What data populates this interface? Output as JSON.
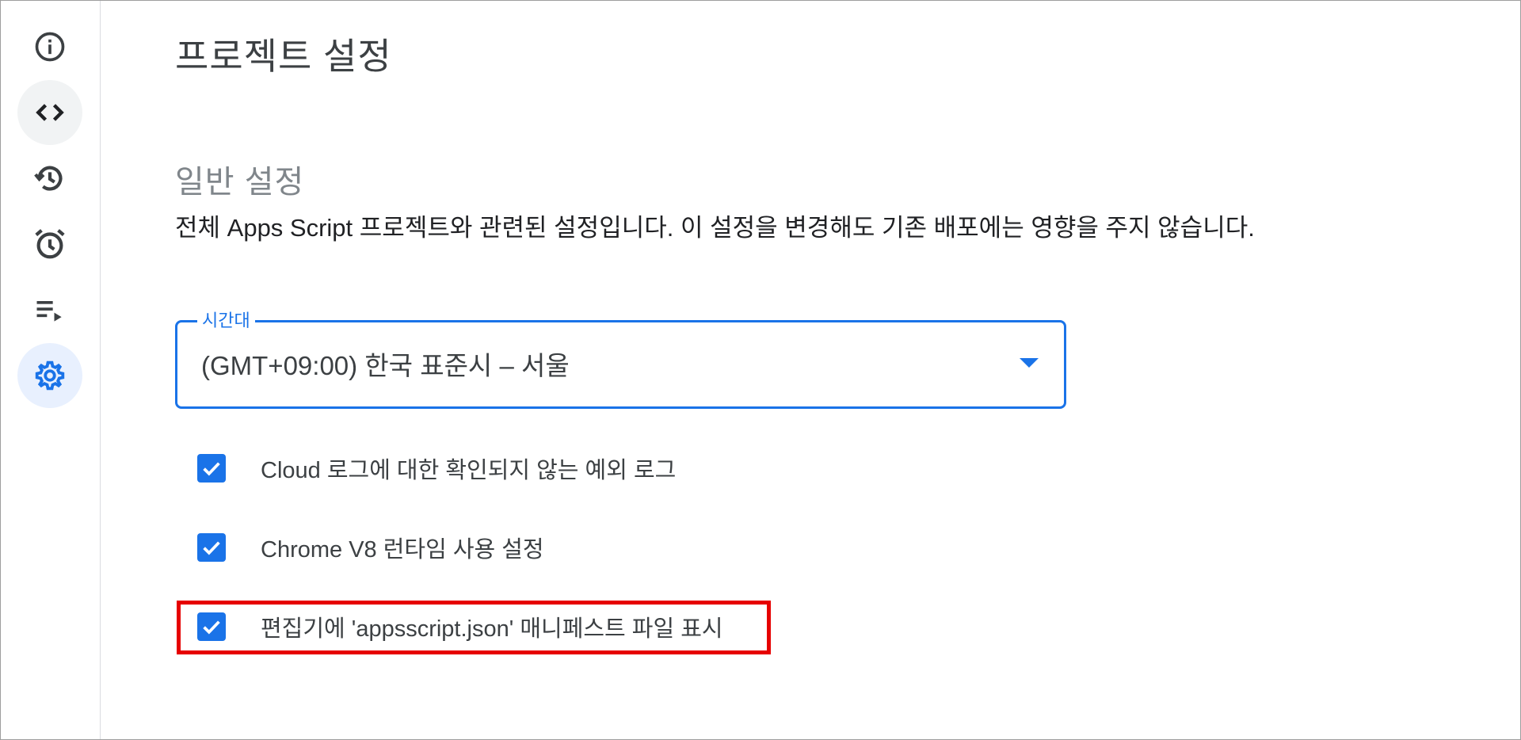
{
  "page": {
    "title": "프로젝트 설정"
  },
  "sidebar": {
    "items": [
      {
        "icon": "info-icon",
        "active": false
      },
      {
        "icon": "code-icon",
        "active": false
      },
      {
        "icon": "history-icon",
        "active": false
      },
      {
        "icon": "alarm-icon",
        "active": false
      },
      {
        "icon": "executions-icon",
        "active": false
      },
      {
        "icon": "gear-icon",
        "active": true
      }
    ]
  },
  "general": {
    "title": "일반 설정",
    "description": "전체 Apps Script 프로젝트와 관련된 설정입니다. 이 설정을 변경해도 기존 배포에는 영향을 주지 않습니다."
  },
  "timezone": {
    "label": "시간대",
    "value": "(GMT+09:00) 한국 표준시 – 서울"
  },
  "options": [
    {
      "label": "Cloud 로그에 대한 확인되지 않는 예외 로그",
      "checked": true
    },
    {
      "label": "Chrome V8 런타임 사용 설정",
      "checked": true
    },
    {
      "label": "편집기에 'appsscript.json' 매니페스트 파일 표시",
      "checked": true
    }
  ],
  "colors": {
    "accent": "#1a73e8",
    "highlight_border": "#e60000",
    "active_nav_bg": "#e8f0fe"
  }
}
